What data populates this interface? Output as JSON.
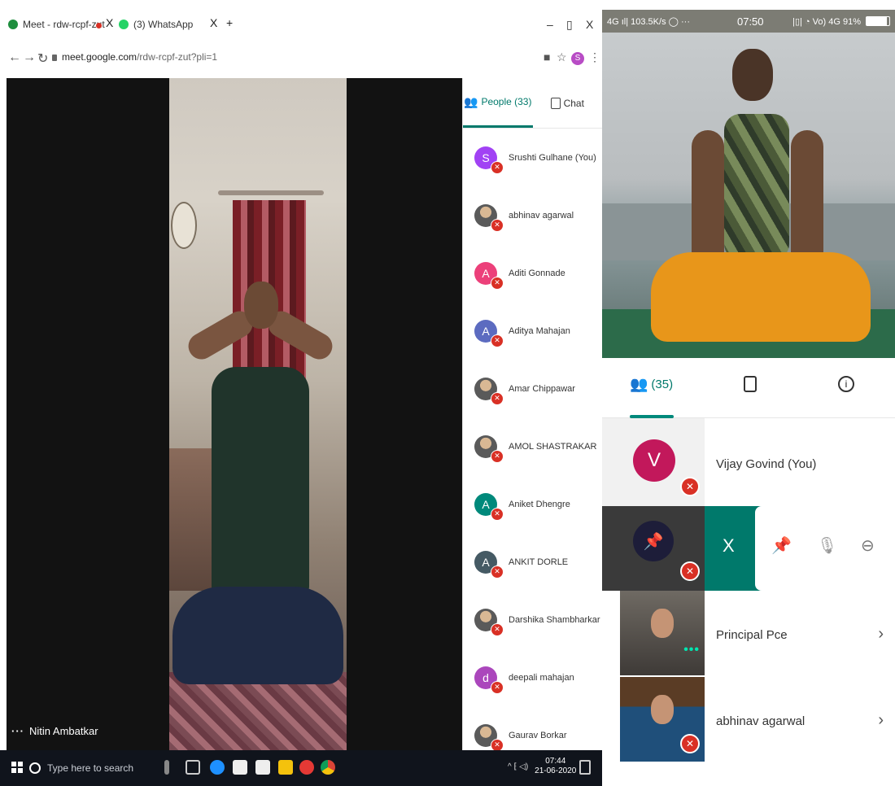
{
  "desktop": {
    "tabs": [
      {
        "label": "Meet - rdw-rcpf-zut",
        "color": "#1e8e3e"
      },
      {
        "label": "(3) WhatsApp",
        "color": "#25d366"
      }
    ],
    "tab_close": "X",
    "new_tab": "+",
    "window_controls": {
      "minimize": "–",
      "restore": "▯",
      "close": "X"
    },
    "address": {
      "host": "meet.google.com",
      "path": "/rdw-rcpf-zut?pli=1"
    },
    "profile_initial": "S",
    "main_speaker": "Nitin Ambatkar",
    "people_panel": {
      "people_tab": "People (33)",
      "chat_tab": "Chat",
      "participants": [
        {
          "name": "Srushti Gulhane (You)",
          "initial": "S",
          "color": "#a142f4"
        },
        {
          "name": "abhinav agarwal",
          "initial": "",
          "color": "#8a8a8a"
        },
        {
          "name": "Aditi Gonnade",
          "initial": "A",
          "color": "#ec407a"
        },
        {
          "name": "Aditya Mahajan",
          "initial": "A",
          "color": "#5c6bc0"
        },
        {
          "name": "Amar Chippawar",
          "initial": "",
          "color": "#6d6d6d"
        },
        {
          "name": "AMOL SHASTRAKAR",
          "initial": "",
          "color": "#6d6d6d"
        },
        {
          "name": "Aniket Dhengre",
          "initial": "A",
          "color": "#00897b"
        },
        {
          "name": "ANKIT DORLE",
          "initial": "A",
          "color": "#455a64"
        },
        {
          "name": "Darshika Shambharkar",
          "initial": "",
          "color": "#222222"
        },
        {
          "name": "deepali mahajan",
          "initial": "d",
          "color": "#ab47bc"
        },
        {
          "name": "Gaurav Borkar",
          "initial": "",
          "color": "#7a6a55"
        }
      ]
    },
    "taskbar": {
      "search_placeholder": "Type here to search",
      "time": "07:44",
      "date": "21-06-2020",
      "tray": "^ ⁅ ◁)"
    }
  },
  "phone": {
    "status": {
      "left": "4G ıl| 103.5K/s ◯ ···",
      "time": "07:50",
      "right": "|▯| ◔ Vo) 4G 91%"
    },
    "tabs": {
      "people_count": "(35)"
    },
    "participants": [
      {
        "name": "Vijay Govind (You)",
        "initial": "V"
      },
      {
        "name": "Principal Pce"
      },
      {
        "name": "abhinav agarwal"
      }
    ],
    "pin_actions": {
      "close": "X"
    }
  }
}
